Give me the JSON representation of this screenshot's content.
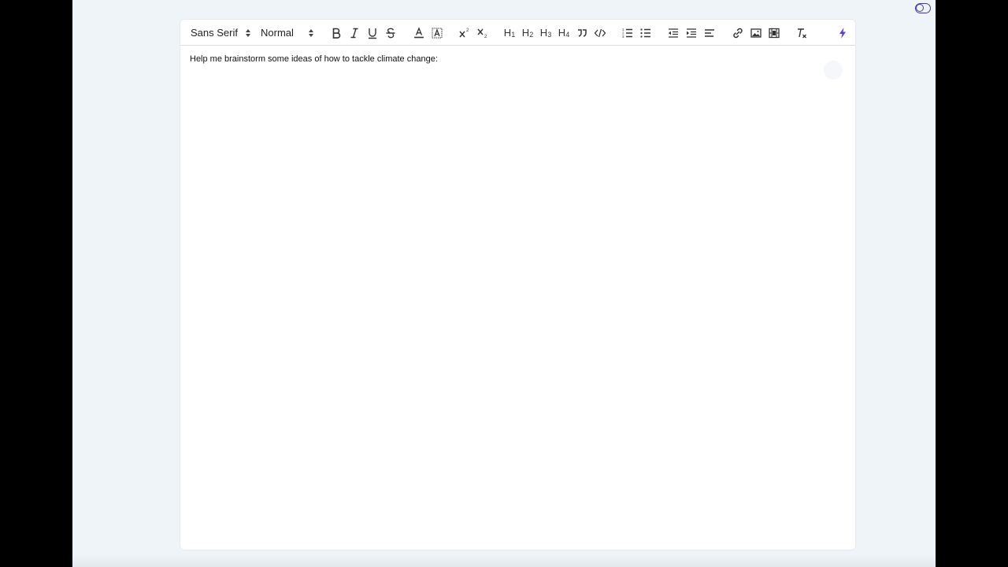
{
  "toolbar": {
    "font_picker": "Sans Serif",
    "size_picker": "Normal",
    "headers": [
      "H1",
      "H2",
      "H3",
      "H4"
    ]
  },
  "editor": {
    "text": "Help me brainstorm some ideas of how to tackle climate change:"
  },
  "icons": {
    "accent_color": "#5b3fd0",
    "toggle_color": "#4a3aa0"
  }
}
